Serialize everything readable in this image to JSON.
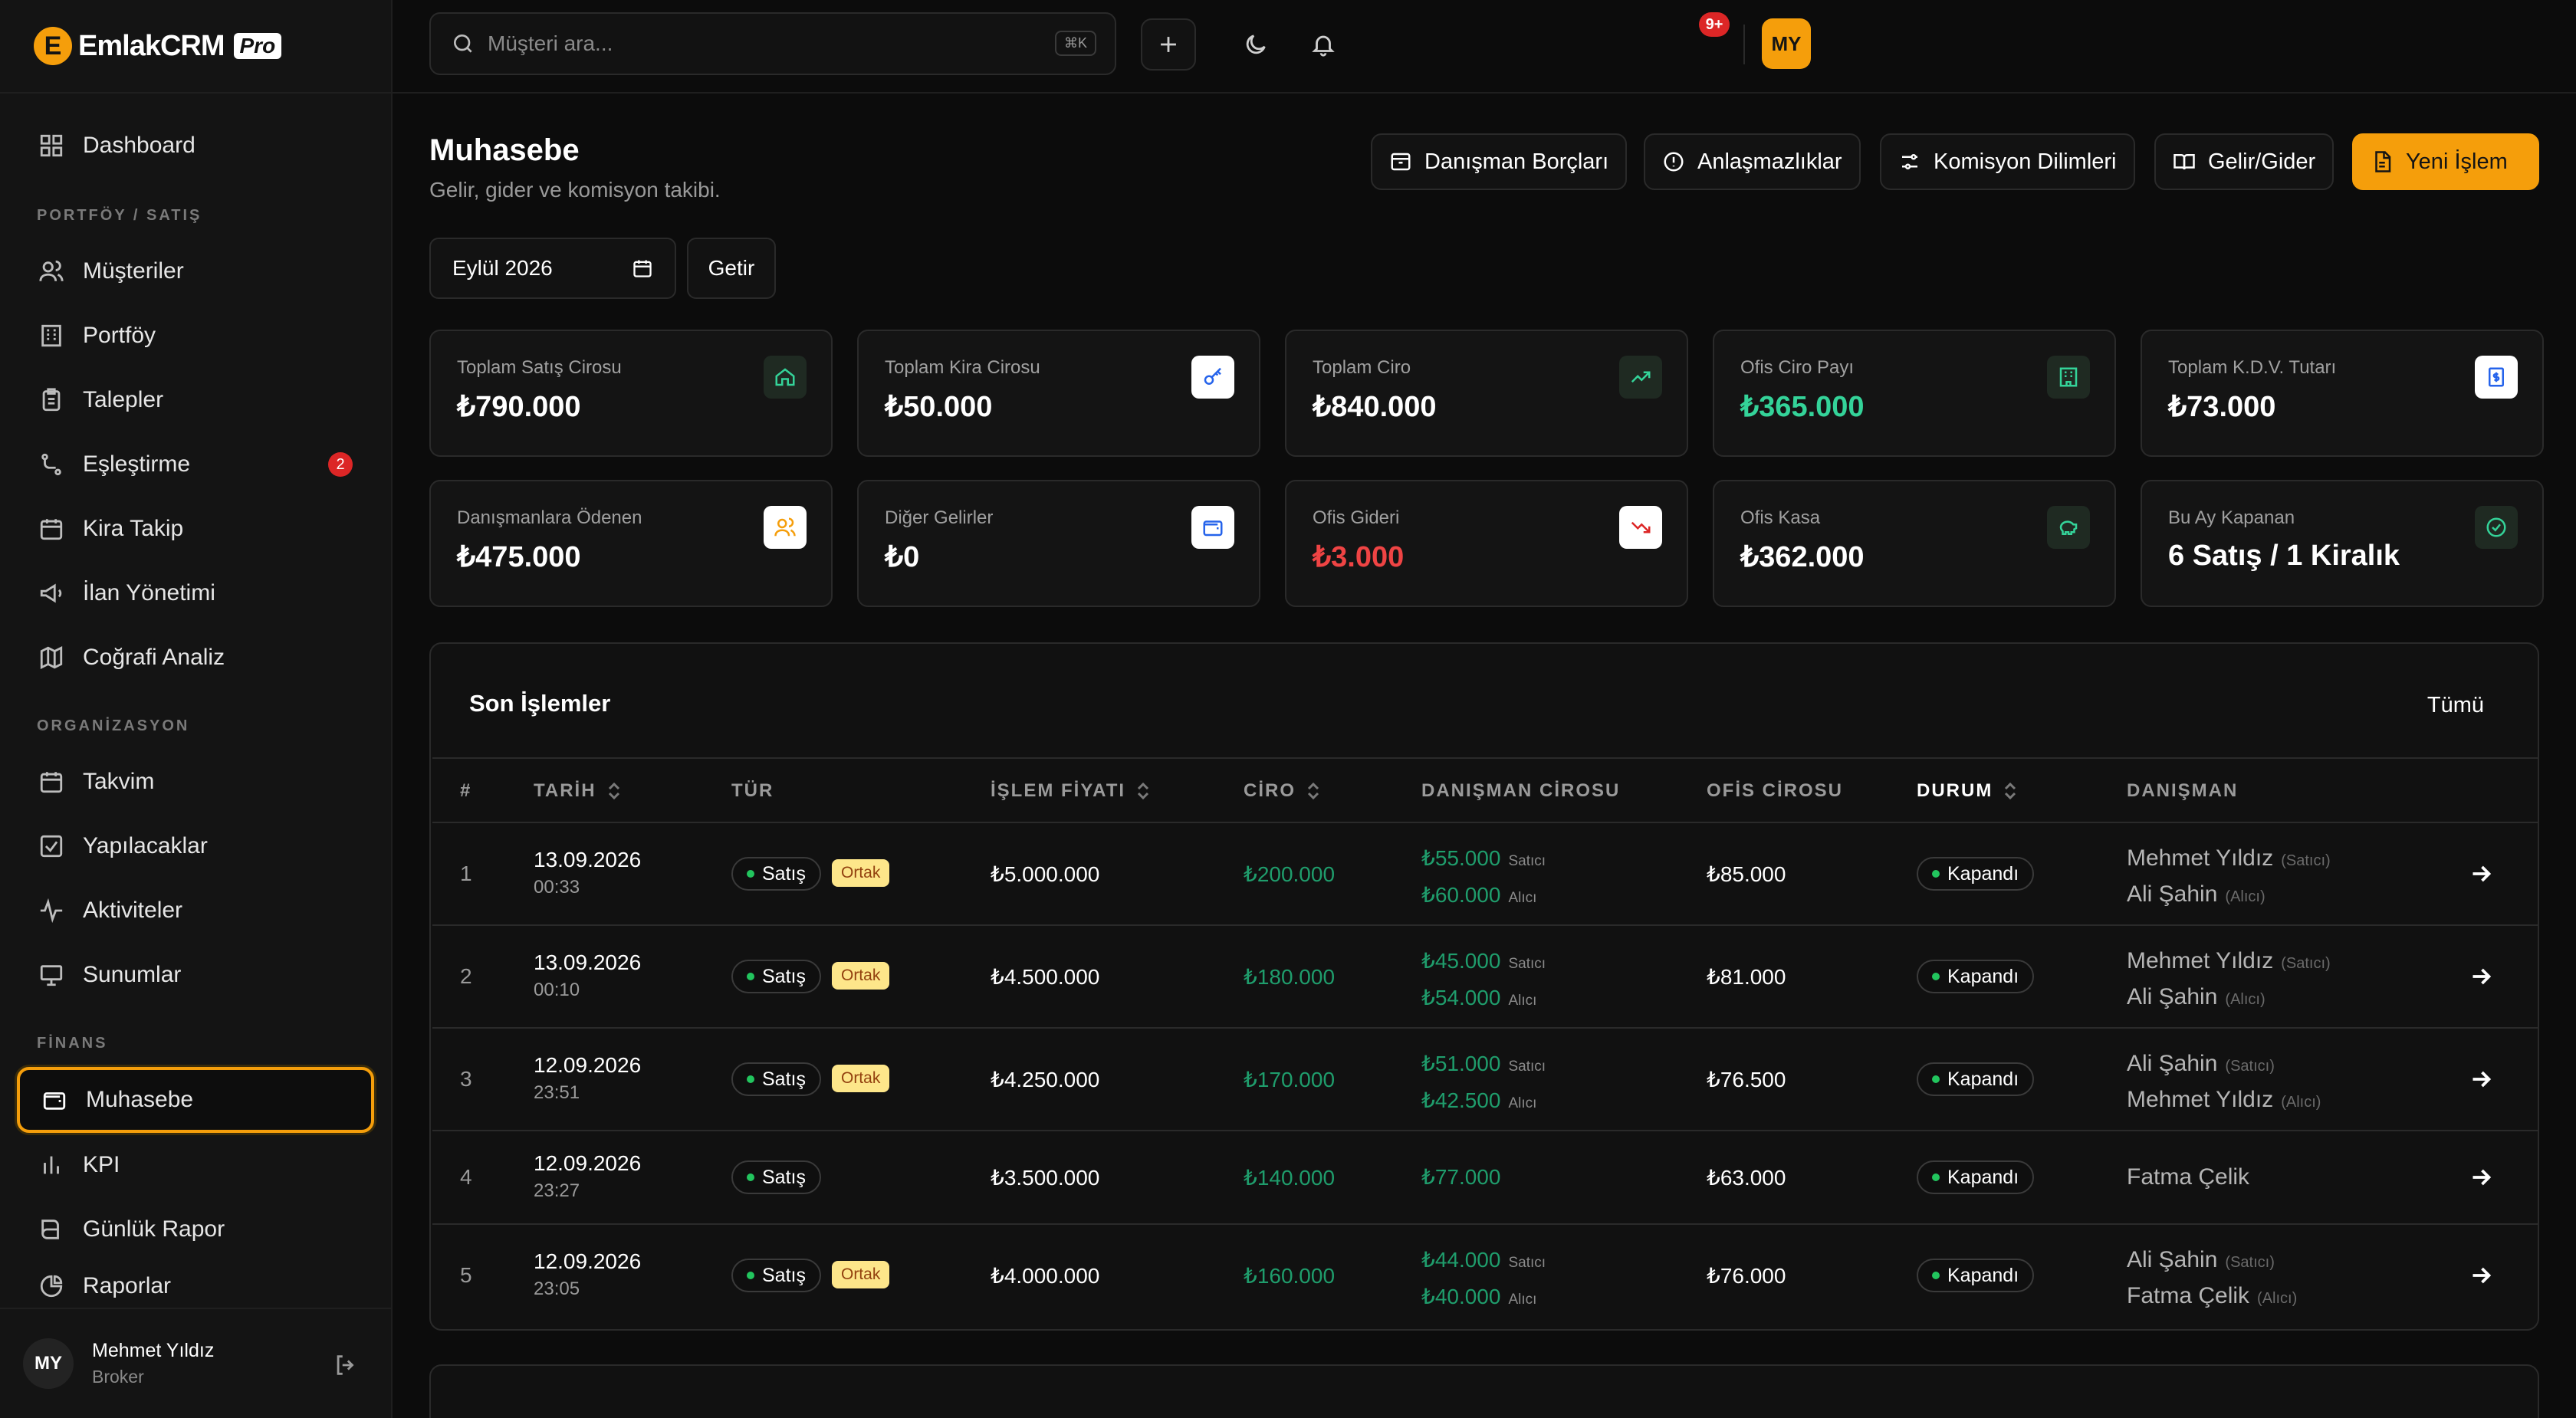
{
  "brand": {
    "logo_letter": "E",
    "name": "EmlakCRM",
    "badge": "Pro",
    "accent": "#f59e0b"
  },
  "sidebar": {
    "top": [
      {
        "label": "Dashboard",
        "icon": "dashboard-icon"
      }
    ],
    "sections": [
      {
        "title": "PORTFÖY / SATIŞ",
        "items": [
          {
            "label": "Müşteriler",
            "icon": "users-icon"
          },
          {
            "label": "Portföy",
            "icon": "building-icon"
          },
          {
            "label": "Talepler",
            "icon": "clipboard-icon"
          },
          {
            "label": "Eşleştirme",
            "icon": "match-icon",
            "badge": "2"
          },
          {
            "label": "Kira Takip",
            "icon": "calendar-icon"
          },
          {
            "label": "İlan Yönetimi",
            "icon": "megaphone-icon"
          },
          {
            "label": "Coğrafi Analiz",
            "icon": "map-icon"
          }
        ]
      },
      {
        "title": "ORGANİZASYON",
        "items": [
          {
            "label": "Takvim",
            "icon": "calendar-icon"
          },
          {
            "label": "Yapılacaklar",
            "icon": "checkbox-icon"
          },
          {
            "label": "Aktiviteler",
            "icon": "activity-icon"
          },
          {
            "label": "Sunumlar",
            "icon": "presentation-icon"
          }
        ]
      },
      {
        "title": "FİNANS",
        "items": [
          {
            "label": "Muhasebe",
            "icon": "wallet-icon",
            "active": true
          },
          {
            "label": "KPI",
            "icon": "bar-chart-icon"
          },
          {
            "label": "Günlük Rapor",
            "icon": "book-icon"
          },
          {
            "label": "Raporlar",
            "icon": "pie-chart-icon"
          }
        ]
      }
    ],
    "user": {
      "initials": "MY",
      "name": "Mehmet Yıldız",
      "role": "Broker"
    }
  },
  "topbar": {
    "search_placeholder": "Müşteri ara...",
    "shortcut": "⌘K",
    "notifications": "9+",
    "avatar": "MY"
  },
  "page": {
    "title": "Muhasebe",
    "subtitle": "Gelir, gider ve komisyon takibi.",
    "actions": [
      "Danışman Borçları",
      "Anlaşmazlıklar",
      "Komisyon Dilimleri",
      "Gelir/Gider",
      "Yeni İşlem"
    ],
    "period": "Eylül 2026",
    "fetch": "Getir"
  },
  "stats": [
    {
      "label": "Toplam Satış Cirosu",
      "value": "₺790.000",
      "tone": "normal",
      "icon": "home-icon"
    },
    {
      "label": "Toplam Kira Cirosu",
      "value": "₺50.000",
      "tone": "normal",
      "icon": "key-icon"
    },
    {
      "label": "Toplam Ciro",
      "value": "₺840.000",
      "tone": "normal",
      "icon": "trending-up-icon"
    },
    {
      "label": "Ofis Ciro Payı",
      "value": "₺365.000",
      "tone": "green",
      "icon": "office-icon"
    },
    {
      "label": "Toplam K.D.V. Tutarı",
      "value": "₺73.000",
      "tone": "normal",
      "icon": "receipt-icon"
    },
    {
      "label": "Danışmanlara Ödenen",
      "value": "₺475.000",
      "tone": "normal",
      "icon": "advisors-icon"
    },
    {
      "label": "Diğer Gelirler",
      "value": "₺0",
      "tone": "normal",
      "icon": "wallet-icon"
    },
    {
      "label": "Ofis Gideri",
      "value": "₺3.000",
      "tone": "red",
      "icon": "trending-down-icon"
    },
    {
      "label": "Ofis Kasa",
      "value": "₺362.000",
      "tone": "normal",
      "icon": "piggy-bank-icon"
    },
    {
      "label": "Bu Ay Kapanan",
      "value": "6 Satış / 1 Kiralık",
      "tone": "normal",
      "icon": "check-circle-icon"
    }
  ],
  "table": {
    "title": "Son İşlemler",
    "all": "Tümü",
    "columns": [
      "#",
      "TARİH",
      "TÜR",
      "İŞLEM FİYATI",
      "CİRO",
      "DANIŞMAN CİROSU",
      "OFİS CİROSU",
      "DURUM",
      "DANIŞMAN"
    ],
    "rows": [
      {
        "no": "1",
        "date": "13.09.2026",
        "time": "00:33",
        "type": "Satış",
        "shared": "Ortak",
        "price": "₺5.000.000",
        "ciro": "₺200.000",
        "adv": [
          {
            "amount": "₺55.000",
            "role": "Satıcı"
          },
          {
            "amount": "₺60.000",
            "role": "Alıcı"
          }
        ],
        "office": "₺85.000",
        "status": "Kapandı",
        "advisors": [
          {
            "name": "Mehmet Yıldız",
            "role": "(Satıcı)"
          },
          {
            "name": "Ali Şahin",
            "role": "(Alıcı)"
          }
        ]
      },
      {
        "no": "2",
        "date": "13.09.2026",
        "time": "00:10",
        "type": "Satış",
        "shared": "Ortak",
        "price": "₺4.500.000",
        "ciro": "₺180.000",
        "adv": [
          {
            "amount": "₺45.000",
            "role": "Satıcı"
          },
          {
            "amount": "₺54.000",
            "role": "Alıcı"
          }
        ],
        "office": "₺81.000",
        "status": "Kapandı",
        "advisors": [
          {
            "name": "Mehmet Yıldız",
            "role": "(Satıcı)"
          },
          {
            "name": "Ali Şahin",
            "role": "(Alıcı)"
          }
        ]
      },
      {
        "no": "3",
        "date": "12.09.2026",
        "time": "23:51",
        "type": "Satış",
        "shared": "Ortak",
        "price": "₺4.250.000",
        "ciro": "₺170.000",
        "adv": [
          {
            "amount": "₺51.000",
            "role": "Satıcı"
          },
          {
            "amount": "₺42.500",
            "role": "Alıcı"
          }
        ],
        "office": "₺76.500",
        "status": "Kapandı",
        "advisors": [
          {
            "name": "Ali Şahin",
            "role": "(Satıcı)"
          },
          {
            "name": "Mehmet Yıldız",
            "role": "(Alıcı)"
          }
        ]
      },
      {
        "no": "4",
        "date": "12.09.2026",
        "time": "23:27",
        "type": "Satış",
        "shared": "",
        "price": "₺3.500.000",
        "ciro": "₺140.000",
        "adv": [
          {
            "amount": "₺77.000",
            "role": ""
          }
        ],
        "office": "₺63.000",
        "status": "Kapandı",
        "advisors": [
          {
            "name": "Fatma Çelik",
            "role": ""
          }
        ]
      },
      {
        "no": "5",
        "date": "12.09.2026",
        "time": "23:05",
        "type": "Satış",
        "shared": "Ortak",
        "price": "₺4.000.000",
        "ciro": "₺160.000",
        "adv": [
          {
            "amount": "₺44.000",
            "role": "Satıcı"
          },
          {
            "amount": "₺40.000",
            "role": "Alıcı"
          }
        ],
        "office": "₺76.000",
        "status": "Kapandı",
        "advisors": [
          {
            "name": "Ali Şahin",
            "role": "(Satıcı)"
          },
          {
            "name": "Fatma Çelik",
            "role": "(Alıcı)"
          }
        ]
      }
    ]
  }
}
